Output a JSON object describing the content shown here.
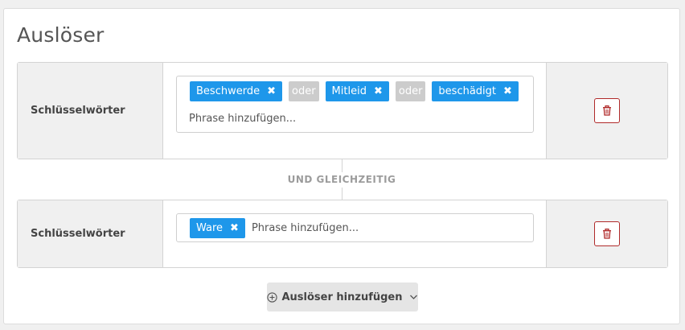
{
  "panel": {
    "title": "Auslöser"
  },
  "triggers": [
    {
      "label": "Schlüsselwörter",
      "tags": [
        "Beschwerde",
        "Mitleid",
        "beschädigt"
      ],
      "conjunction": "oder",
      "placeholder": "Phrase hinzufügen..."
    },
    {
      "label": "Schlüsselwörter",
      "tags": [
        "Ware"
      ],
      "placeholder": "Phrase hinzufügen..."
    }
  ],
  "connector": {
    "label": "UND GLEICHZEITIG"
  },
  "add_button": {
    "label": "Auslöser hinzufügen"
  },
  "icons": {
    "remove_tag": "close-icon",
    "delete": "trash-icon",
    "add": "plus-circle-icon",
    "dropdown": "chevron-down-icon"
  },
  "colors": {
    "tag": "#1e97ea",
    "conjunction": "#cccccc",
    "delete": "#b02a2a"
  }
}
